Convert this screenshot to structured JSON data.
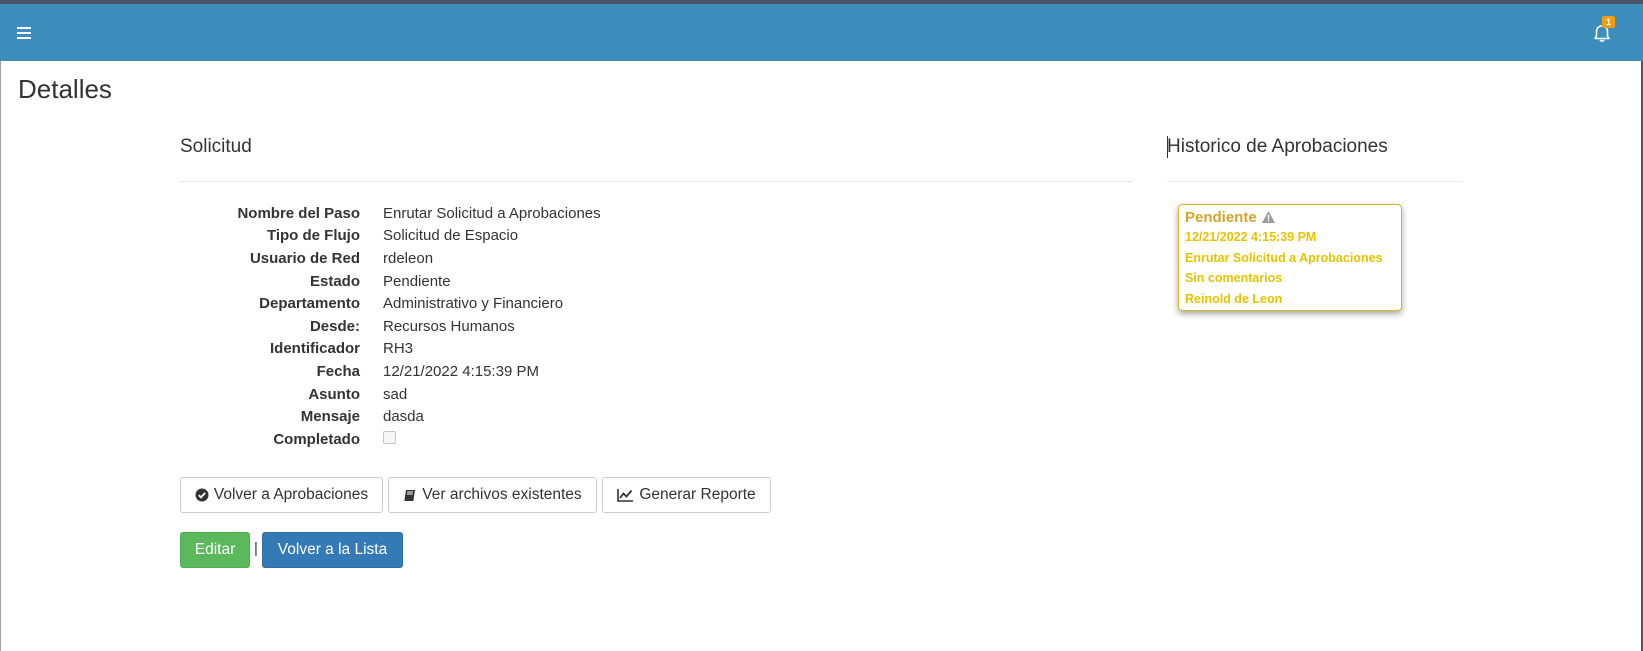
{
  "header": {
    "menu_icon": "hamburger-icon",
    "notification_icon": "bell-icon",
    "notification_count": "1",
    "navbar_color": "#3c8dbc"
  },
  "page": {
    "title": "Detalles"
  },
  "solicitud": {
    "title": "Solicitud",
    "fields": [
      {
        "label": "Nombre del Paso",
        "value": "Enrutar Solicitud a Aprobaciones"
      },
      {
        "label": "Tipo de Flujo",
        "value": "Solicitud de Espacio"
      },
      {
        "label": "Usuario de Red",
        "value": "rdeleon"
      },
      {
        "label": "Estado",
        "value": "Pendiente"
      },
      {
        "label": "Departamento",
        "value": "Administrativo y Financiero"
      },
      {
        "label": "Desde:",
        "value": "Recursos Humanos"
      },
      {
        "label": "Identificador",
        "value": "RH3"
      },
      {
        "label": "Fecha",
        "value": "12/21/2022 4:15:39 PM"
      },
      {
        "label": "Asunto",
        "value": "sad"
      },
      {
        "label": "Mensaje",
        "value": "dasda"
      },
      {
        "label": "Completado",
        "value": ""
      }
    ],
    "completado_checked": false
  },
  "actions": {
    "volver_aprobaciones": {
      "label": "Volver a Aprobaciones",
      "icon": "check-circle-icon"
    },
    "ver_archivos": {
      "label": "Ver archivos existentes",
      "icon": "book-icon"
    },
    "generar_reporte": {
      "label": "Generar Reporte",
      "icon": "line-chart-icon"
    },
    "editar": {
      "label": "Editar",
      "color": "#5cb85c"
    },
    "separator": "|",
    "volver_lista": {
      "label": "Volver a la Lista",
      "color": "#337ab7"
    }
  },
  "historico": {
    "title": "Historico de Aprobaciones",
    "card": {
      "status": "Pendiente",
      "status_icon": "warning-icon",
      "date": "12/21/2022 4:15:39 PM",
      "step": "Enrutar Solicitud a Aprobaciones",
      "comment": "Sin comentarios",
      "user": "Reinold de Leon",
      "accent_color": "#e6c300"
    }
  }
}
